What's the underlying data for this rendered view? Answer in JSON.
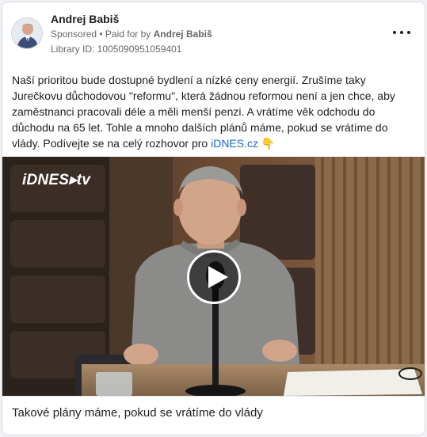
{
  "ad": {
    "page_name": "Andrej Babiš",
    "sponsored_label": "Sponsored",
    "separator": " • ",
    "paid_prefix": "Paid for by ",
    "paid_by": "Andrej Babiš",
    "library_id": "Library ID: 1005090951059401",
    "body_text": "Naší prioritou bude dostupné bydlení a nízké ceny energií. Zrušíme taky Jurečkovu důchodovou \"reformu\", která žádnou reformou není a jen chce, aby zaměstnanci pracovali déle a měli menší penzi. A vrátíme věk odchodu do důchodu na 65 let. Tohle a mnoho dalších plánů máme, pokud se vrátíme do vlády. Podívejte se na celý rozhovor pro ",
    "body_link": "iDNES.cz",
    "body_emoji": " 👇",
    "video_logo": "iDNES▸tv",
    "caption": "Takové plány máme, pokud se vrátíme do vlády"
  },
  "icons": {
    "more": "more-horizontal-icon",
    "play": "play-icon"
  },
  "colors": {
    "link": "#1a66c2",
    "meta_text": "#65676b",
    "card_border": "#d7d9dd"
  }
}
